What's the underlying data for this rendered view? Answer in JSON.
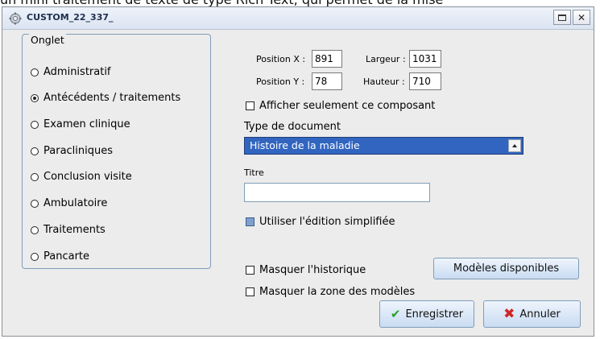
{
  "background_text": "un mini traitement de texte de type Rich Text, qui permet de la mise",
  "window": {
    "title": "CUSTOM_22_337_",
    "maximize_label": "",
    "close_label": "✕"
  },
  "onglet": {
    "legend": "Onglet",
    "options": [
      {
        "label": "Administratif",
        "checked": false
      },
      {
        "label": "Antécédents / traitements",
        "checked": true
      },
      {
        "label": "Examen clinique",
        "checked": false
      },
      {
        "label": "Paracliniques",
        "checked": false
      },
      {
        "label": "Conclusion visite",
        "checked": false
      },
      {
        "label": "Ambulatoire",
        "checked": false
      },
      {
        "label": "Traitements",
        "checked": false
      },
      {
        "label": "Pancarte",
        "checked": false
      }
    ]
  },
  "position": {
    "x_label": "Position X :",
    "x_value": "891",
    "y_label": "Position Y :",
    "y_value": "78",
    "width_label": "Largeur :",
    "width_value": "1031",
    "height_label": "Hauteur :",
    "height_value": "710"
  },
  "options": {
    "show_only_label": "Afficher seulement ce composant",
    "doc_type_label": "Type de document",
    "doc_type_value": "Histoire de la maladie",
    "titre_label": "Titre",
    "titre_value": "",
    "simplified_label": "Utiliser l'édition simplifiée",
    "hide_history_label": "Masquer l'historique",
    "hide_models_label": "Masquer la zone des modèles"
  },
  "buttons": {
    "models": "Modèles disponibles",
    "save": "Enregistrer",
    "cancel": "Annuler"
  }
}
